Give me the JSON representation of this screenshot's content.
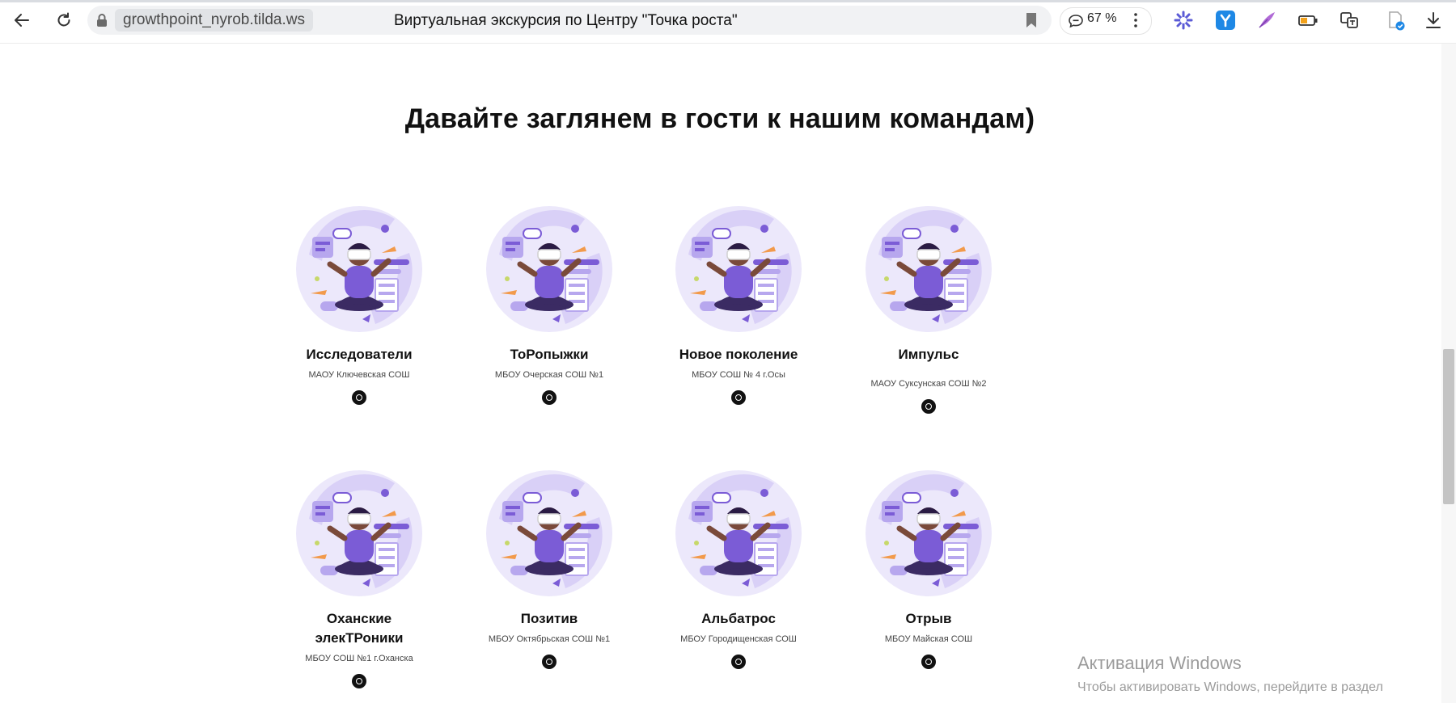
{
  "browser": {
    "url": "growthpoint_nyrob.tilda.ws",
    "tab_title": "Виртуальная экскурсия по Центру \"Точка роста\"",
    "zoom": "67 %"
  },
  "page": {
    "heading": "Давайте заглянем в гости к нашим командам)",
    "teams": [
      {
        "name": "Исследователи",
        "school": "МАОУ Ключевская СОШ"
      },
      {
        "name": "ТоРопыжки",
        "school": "МБОУ Очерская СОШ №1"
      },
      {
        "name": "Новое поколение",
        "school": "МБОУ СОШ № 4 г.Осы"
      },
      {
        "name": "Импульс",
        "school": "МАОУ Суксунская СОШ №2"
      },
      {
        "name": "Оханские элекТРоники",
        "school": "МБОУ СОШ №1 г.Оханска"
      },
      {
        "name": "Позитив",
        "school": "МБОУ Октябрьская СОШ №1"
      },
      {
        "name": "Альбатрос",
        "school": "МБОУ Городищенская СОШ"
      },
      {
        "name": "Отрыв",
        "school": "МБОУ Майская СОШ"
      }
    ]
  },
  "watermark": {
    "title": "Активация Windows",
    "subtitle": "Чтобы активировать Windows, перейдите в раздел"
  },
  "colors": {
    "accent_purple": "#7b5cd6",
    "light_purple": "#ece8fb",
    "dark_text": "#111111"
  }
}
